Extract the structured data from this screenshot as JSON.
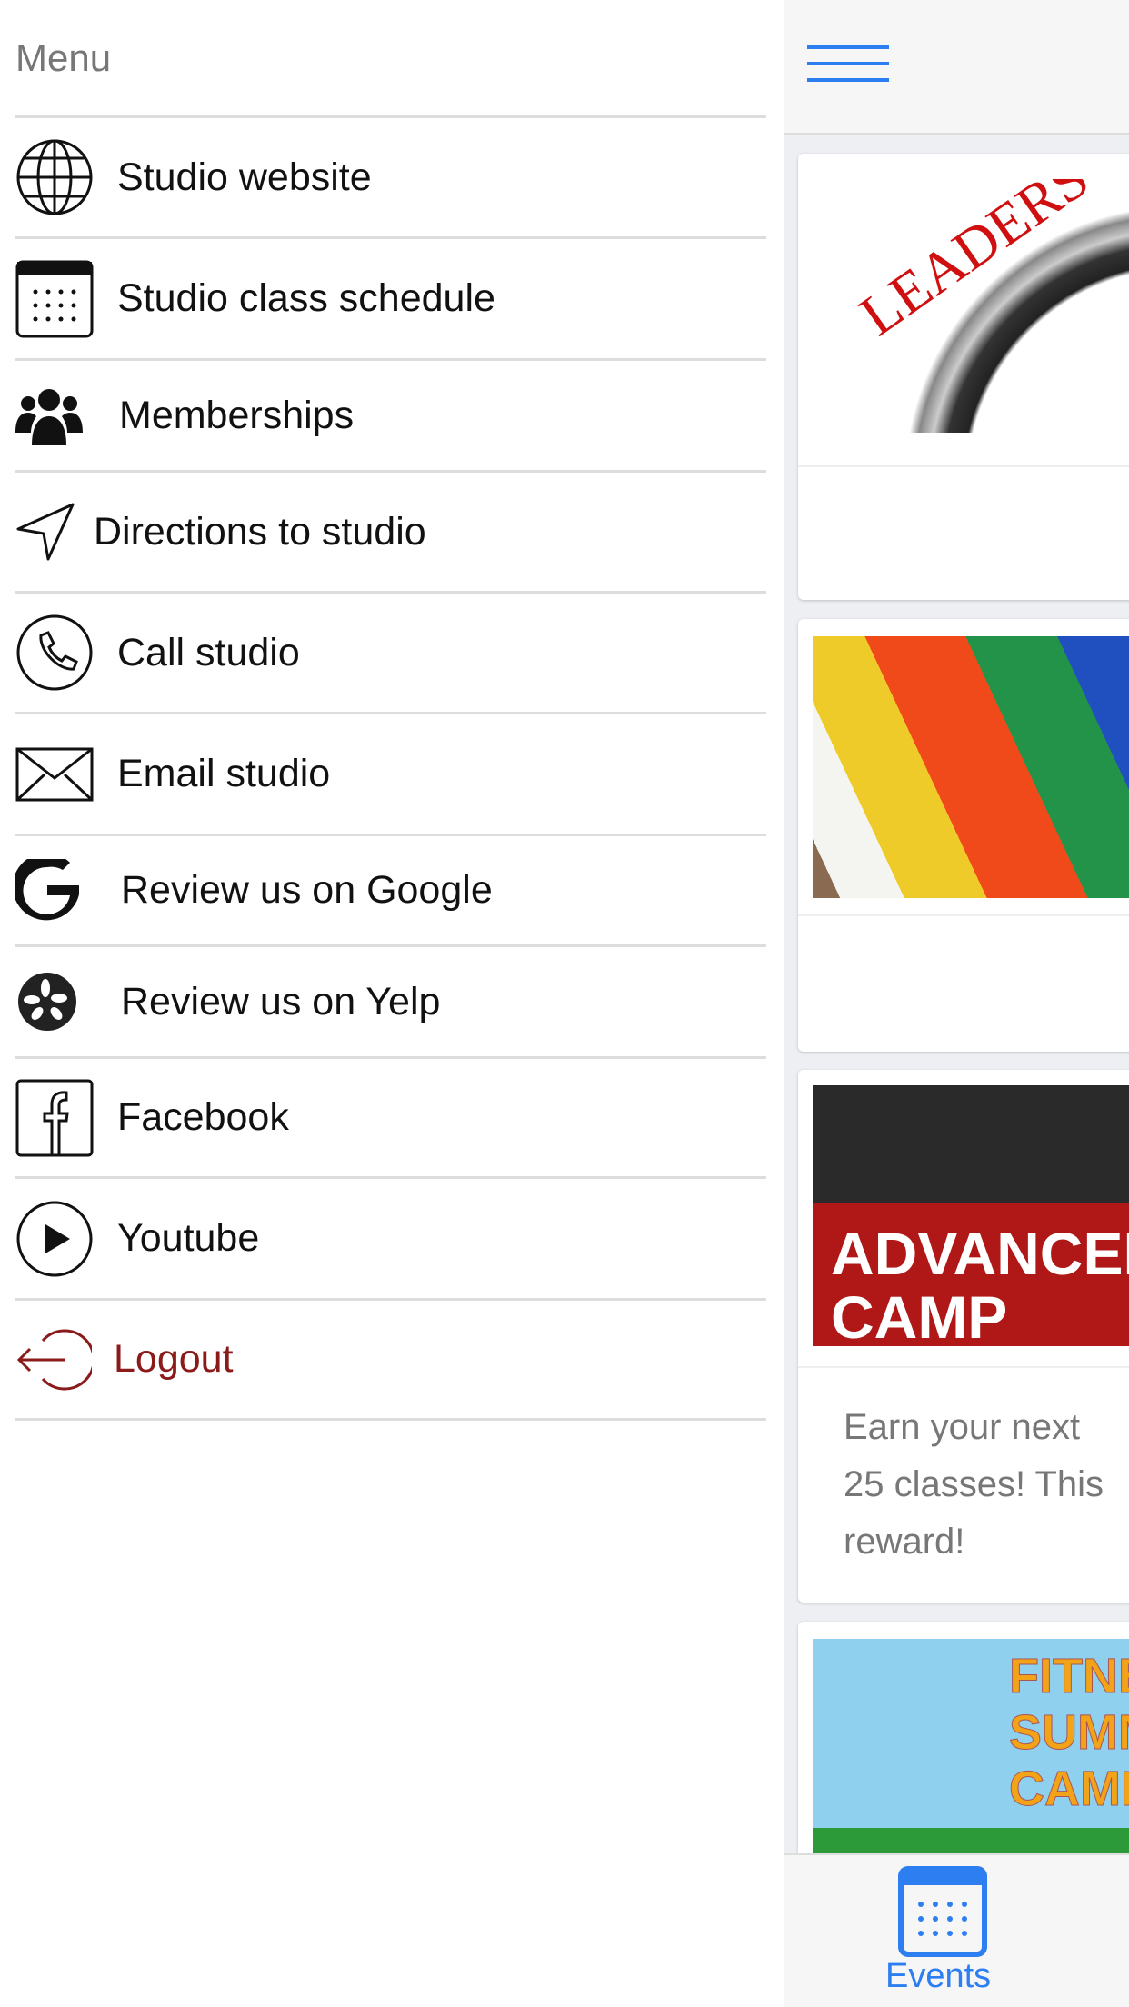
{
  "menu": {
    "title": "Menu",
    "items": [
      {
        "label": "Studio website",
        "icon": "globe-icon"
      },
      {
        "label": "Studio class schedule",
        "icon": "calendar-icon"
      },
      {
        "label": "Memberships",
        "icon": "users-icon"
      },
      {
        "label": "Directions to studio",
        "icon": "navigation-arrow-icon"
      },
      {
        "label": "Call studio",
        "icon": "phone-icon"
      },
      {
        "label": "Email studio",
        "icon": "envelope-icon"
      },
      {
        "label": "Review us on Google",
        "icon": "google-icon"
      },
      {
        "label": "Review us on Yelp",
        "icon": "yelp-icon"
      },
      {
        "label": "Facebook",
        "icon": "facebook-icon"
      },
      {
        "label": "Youtube",
        "icon": "play-icon"
      },
      {
        "label": "Logout",
        "icon": "logout-icon"
      }
    ]
  },
  "main": {
    "cards": [
      {
        "image_text": "LEADERS",
        "body": ""
      },
      {
        "image_text": "",
        "body": ""
      },
      {
        "image_text": "ADVANCEM CAMP",
        "body_lines": [
          "Earn your next",
          "25 classes! This",
          "reward!"
        ]
      },
      {
        "image_text": "FITNESS SUMMER CAMP"
      }
    ]
  },
  "bottom_nav": {
    "events_label": "Events",
    "active_color": "#2d7ef0"
  },
  "colors": {
    "accent": "#2d7ef0",
    "logout": "#8b1a1a"
  }
}
